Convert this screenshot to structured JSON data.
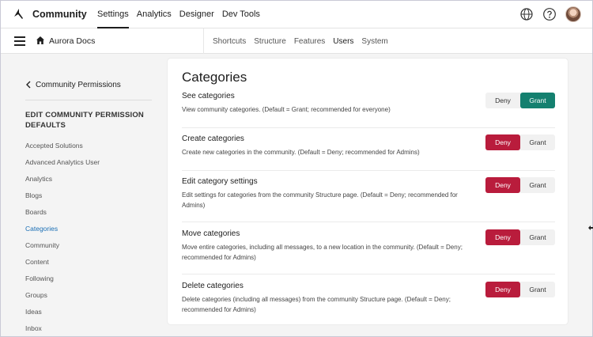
{
  "app": {
    "name": "Community"
  },
  "topnav": [
    {
      "label": "Settings",
      "active": true
    },
    {
      "label": "Analytics",
      "active": false
    },
    {
      "label": "Designer",
      "active": false
    },
    {
      "label": "Dev Tools",
      "active": false
    }
  ],
  "top_icons": [
    "globe-icon",
    "help-icon",
    "avatar"
  ],
  "subbar": {
    "site_name": "Aurora Docs",
    "items": [
      {
        "label": "Shortcuts",
        "active": false
      },
      {
        "label": "Structure",
        "active": false
      },
      {
        "label": "Features",
        "active": false
      },
      {
        "label": "Users",
        "active": true
      },
      {
        "label": "System",
        "active": false
      }
    ]
  },
  "sidebar": {
    "back_label": "Community Permissions",
    "section_title": "EDIT COMMUNITY PERMISSION DEFAULTS",
    "items": [
      {
        "label": "Accepted Solutions",
        "active": false
      },
      {
        "label": "Advanced Analytics User",
        "active": false
      },
      {
        "label": "Analytics",
        "active": false
      },
      {
        "label": "Blogs",
        "active": false
      },
      {
        "label": "Boards",
        "active": false
      },
      {
        "label": "Categories",
        "active": true
      },
      {
        "label": "Community",
        "active": false
      },
      {
        "label": "Content",
        "active": false
      },
      {
        "label": "Following",
        "active": false
      },
      {
        "label": "Groups",
        "active": false
      },
      {
        "label": "Ideas",
        "active": false
      },
      {
        "label": "Inbox",
        "active": false
      }
    ]
  },
  "main": {
    "title": "Categories",
    "permissions": [
      {
        "name": "See categories",
        "description": "View community categories. (Default = Grant; recommended for everyone)",
        "value": "Grant"
      },
      {
        "name": "Create categories",
        "description": "Create new categories in the community. (Default = Deny; recommended for Admins)",
        "value": "Deny"
      },
      {
        "name": "Edit category settings",
        "description": "Edit settings for categories from the community Structure page. (Default = Deny; recommended for Admins)",
        "value": "Deny"
      },
      {
        "name": "Move categories",
        "description": "Move entire categories, including all messages, to a new location in the community. (Default = Deny; recommended for Admins)",
        "value": "Deny"
      },
      {
        "name": "Delete categories",
        "description": "Delete categories (including all messages) from the community Structure page. (Default = Deny; recommended for Admins)",
        "value": "Deny"
      }
    ],
    "deny_label": "Deny",
    "grant_label": "Grant"
  },
  "colors": {
    "grant": "#14806f",
    "deny": "#b91c3c",
    "active_link": "#1b6fb5"
  }
}
